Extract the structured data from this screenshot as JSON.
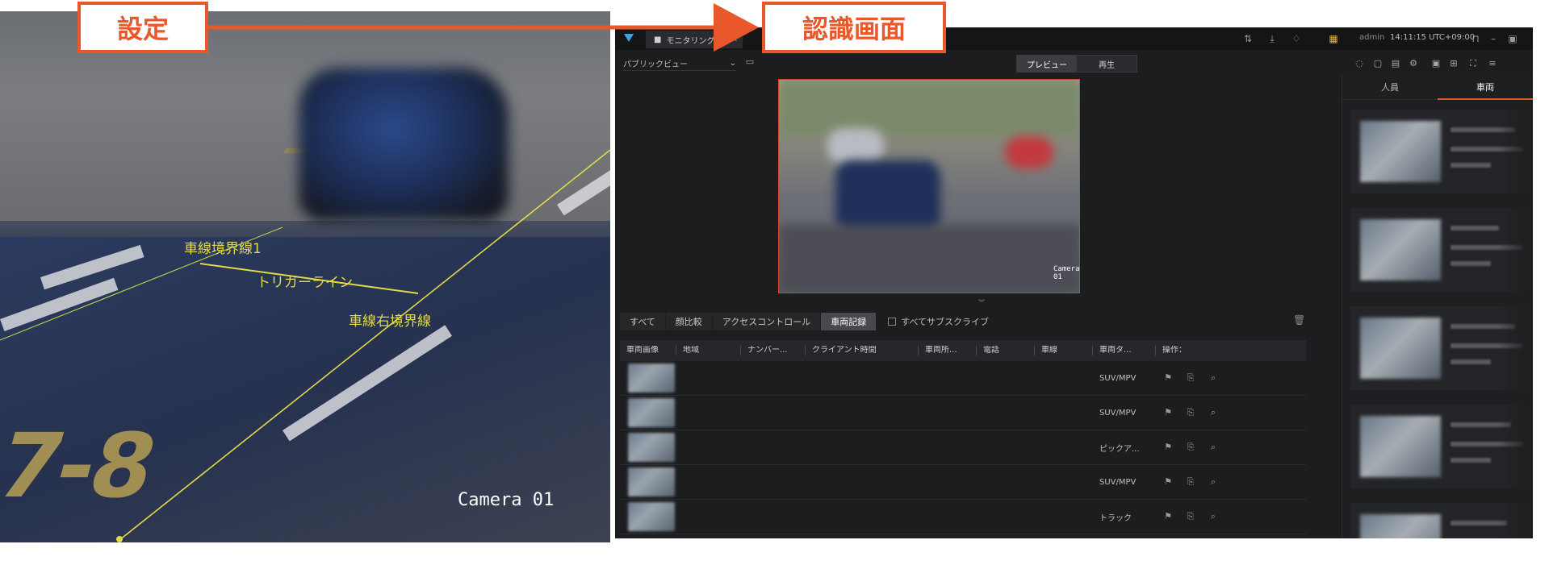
{
  "callouts": {
    "left": "設定",
    "right": "認識画面"
  },
  "camera_left": {
    "label": "Camera 01",
    "lines": {
      "left_boundary": "車線境界線1",
      "trigger": "トリガーライン",
      "right_boundary": "車線右境界線"
    },
    "ground_text": "7-8",
    "line_color": "#e3d94a"
  },
  "app": {
    "tab_label": "モニタリング",
    "tab_icon": "video-camera-icon",
    "user": "admin",
    "time": "14:11:15 UTC+09:00",
    "view_select": "パブリックビュー",
    "mode": {
      "preview": "プレビュー",
      "playback": "再生"
    },
    "video_label": "Camera 01",
    "filters": [
      "すべて",
      "顔比較",
      "アクセスコントロール",
      "車両記録"
    ],
    "subscribe_all": "すべてサブスクライブ",
    "table": {
      "headers": [
        "車両画像",
        "地域",
        "ナンバー...",
        "クライアント時間",
        "車両所...",
        "電話",
        "車線",
        "車両タ...",
        "操作："
      ],
      "rows": [
        {
          "region": "",
          "plate": "",
          "time": "",
          "type": "SUV/MPV"
        },
        {
          "region": "",
          "plate": "",
          "time": "",
          "type": "SUV/MPV"
        },
        {
          "region": "",
          "plate": "",
          "time": "",
          "type": "ピックア..."
        },
        {
          "region": "",
          "plate": "",
          "time": "",
          "type": "SUV/MPV"
        },
        {
          "region": "",
          "plate": "",
          "time": "",
          "type": "トラック"
        }
      ]
    },
    "sidebar": {
      "tabs": [
        "人員",
        "車両"
      ]
    },
    "accent_color": "#e05a2a"
  }
}
